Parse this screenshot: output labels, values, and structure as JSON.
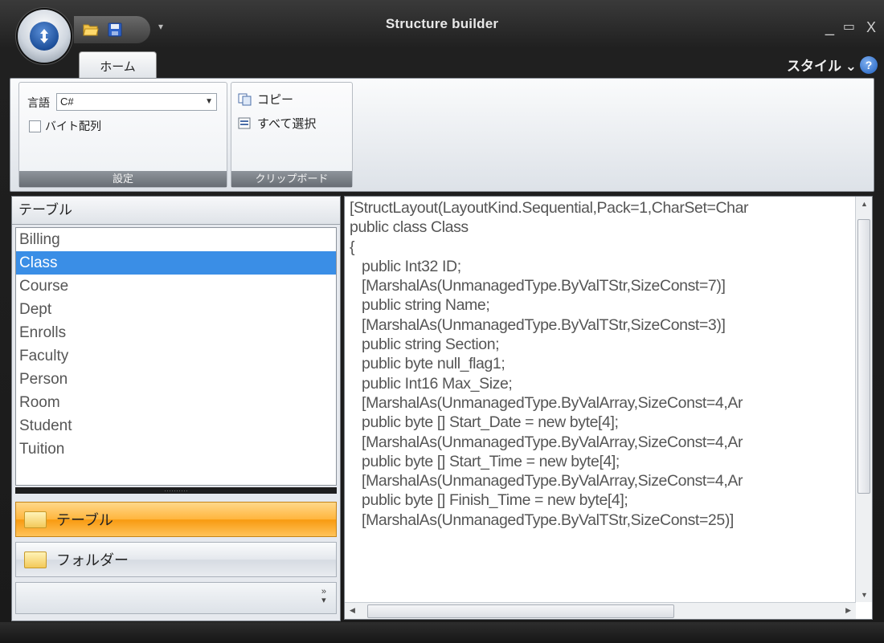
{
  "window": {
    "title": "Structure builder",
    "controls": {
      "minimize": "_",
      "maximize": "▭",
      "close": "X"
    }
  },
  "ribbon": {
    "tab_home": "ホーム",
    "style_menu": "スタイル ⌄",
    "help": "?",
    "settings": {
      "language_label": "言語",
      "language_value": "C#",
      "byte_array_label": "バイト配列",
      "group_label": "設定"
    },
    "clipboard": {
      "copy_label": "コピー",
      "select_all_label": "すべて選択",
      "group_label": "クリップボード"
    }
  },
  "left_panel": {
    "header": "テーブル",
    "tables": [
      "Billing",
      "Class",
      "Course",
      "Dept",
      "Enrolls",
      "Faculty",
      "Person",
      "Room",
      "Student",
      "Tuition"
    ],
    "selected": "Class",
    "nav": {
      "tables": "テーブル",
      "folders": "フォルダー"
    }
  },
  "code": [
    "[StructLayout(LayoutKind.Sequential,Pack=1,CharSet=Char",
    "public class Class",
    "{",
    "   public Int32 ID;",
    "   [MarshalAs(UnmanagedType.ByValTStr,SizeConst=7)]",
    "   public string Name;",
    "   [MarshalAs(UnmanagedType.ByValTStr,SizeConst=3)]",
    "   public string Section;",
    "   public byte null_flag1;",
    "   public Int16 Max_Size;",
    "   [MarshalAs(UnmanagedType.ByValArray,SizeConst=4,Ar",
    "   public byte [] Start_Date = new byte[4];",
    "   [MarshalAs(UnmanagedType.ByValArray,SizeConst=4,Ar",
    "   public byte [] Start_Time = new byte[4];",
    "   [MarshalAs(UnmanagedType.ByValArray,SizeConst=4,Ar",
    "   public byte [] Finish_Time = new byte[4];",
    "   [MarshalAs(UnmanagedType.ByValTStr,SizeConst=25)]"
  ],
  "colors": {
    "selection": "#3a8ee6",
    "active_nav": "#ffb53d"
  }
}
